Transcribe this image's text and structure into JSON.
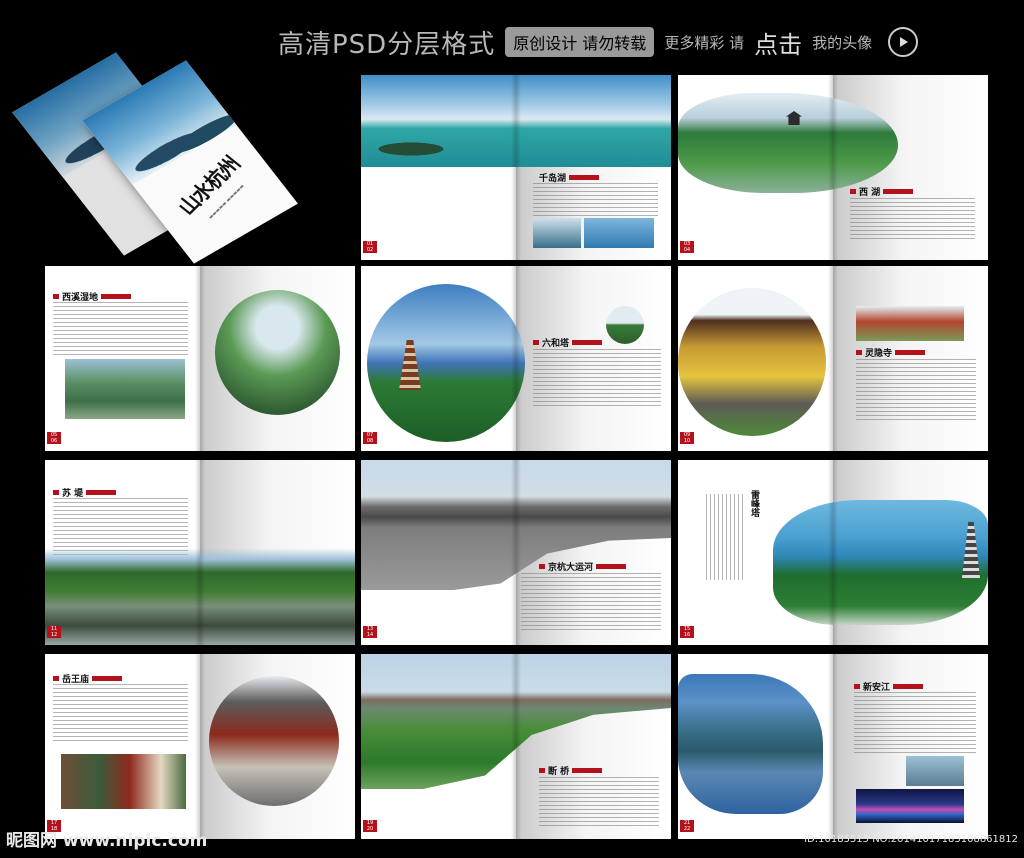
{
  "banner": {
    "title": "高清PSD分层格式",
    "tag": "原创设计 请勿转载",
    "more": "更多精彩 请",
    "click": "点击",
    "avatar": "我的头像"
  },
  "cover": {
    "title": "山水杭州"
  },
  "spreads": [
    {
      "title": "千岛湖",
      "pages": "01 02"
    },
    {
      "title": "西 湖",
      "pages": "03 04"
    },
    {
      "title": "西溪湿地",
      "pages": "05 06"
    },
    {
      "title": "六和塔",
      "pages": "07 08"
    },
    {
      "title": "灵隐寺",
      "pages": "09 10"
    },
    {
      "title": "苏 堤",
      "pages": "11 12"
    },
    {
      "title": "京杭大运河",
      "pages": "13 14"
    },
    {
      "title": "雷峰塔",
      "pages": "15 16"
    },
    {
      "title": "岳王庙",
      "pages": "17 18"
    },
    {
      "title": "断 桥",
      "pages": "19 20"
    },
    {
      "title": "新安江",
      "pages": "21 22"
    }
  ],
  "footer": {
    "watermark": "昵图网 www.nipic.com",
    "id_text": "ID:10185515 NO:20141017183108861812"
  },
  "colors": {
    "accent": "#b3121c",
    "background": "#000000"
  }
}
